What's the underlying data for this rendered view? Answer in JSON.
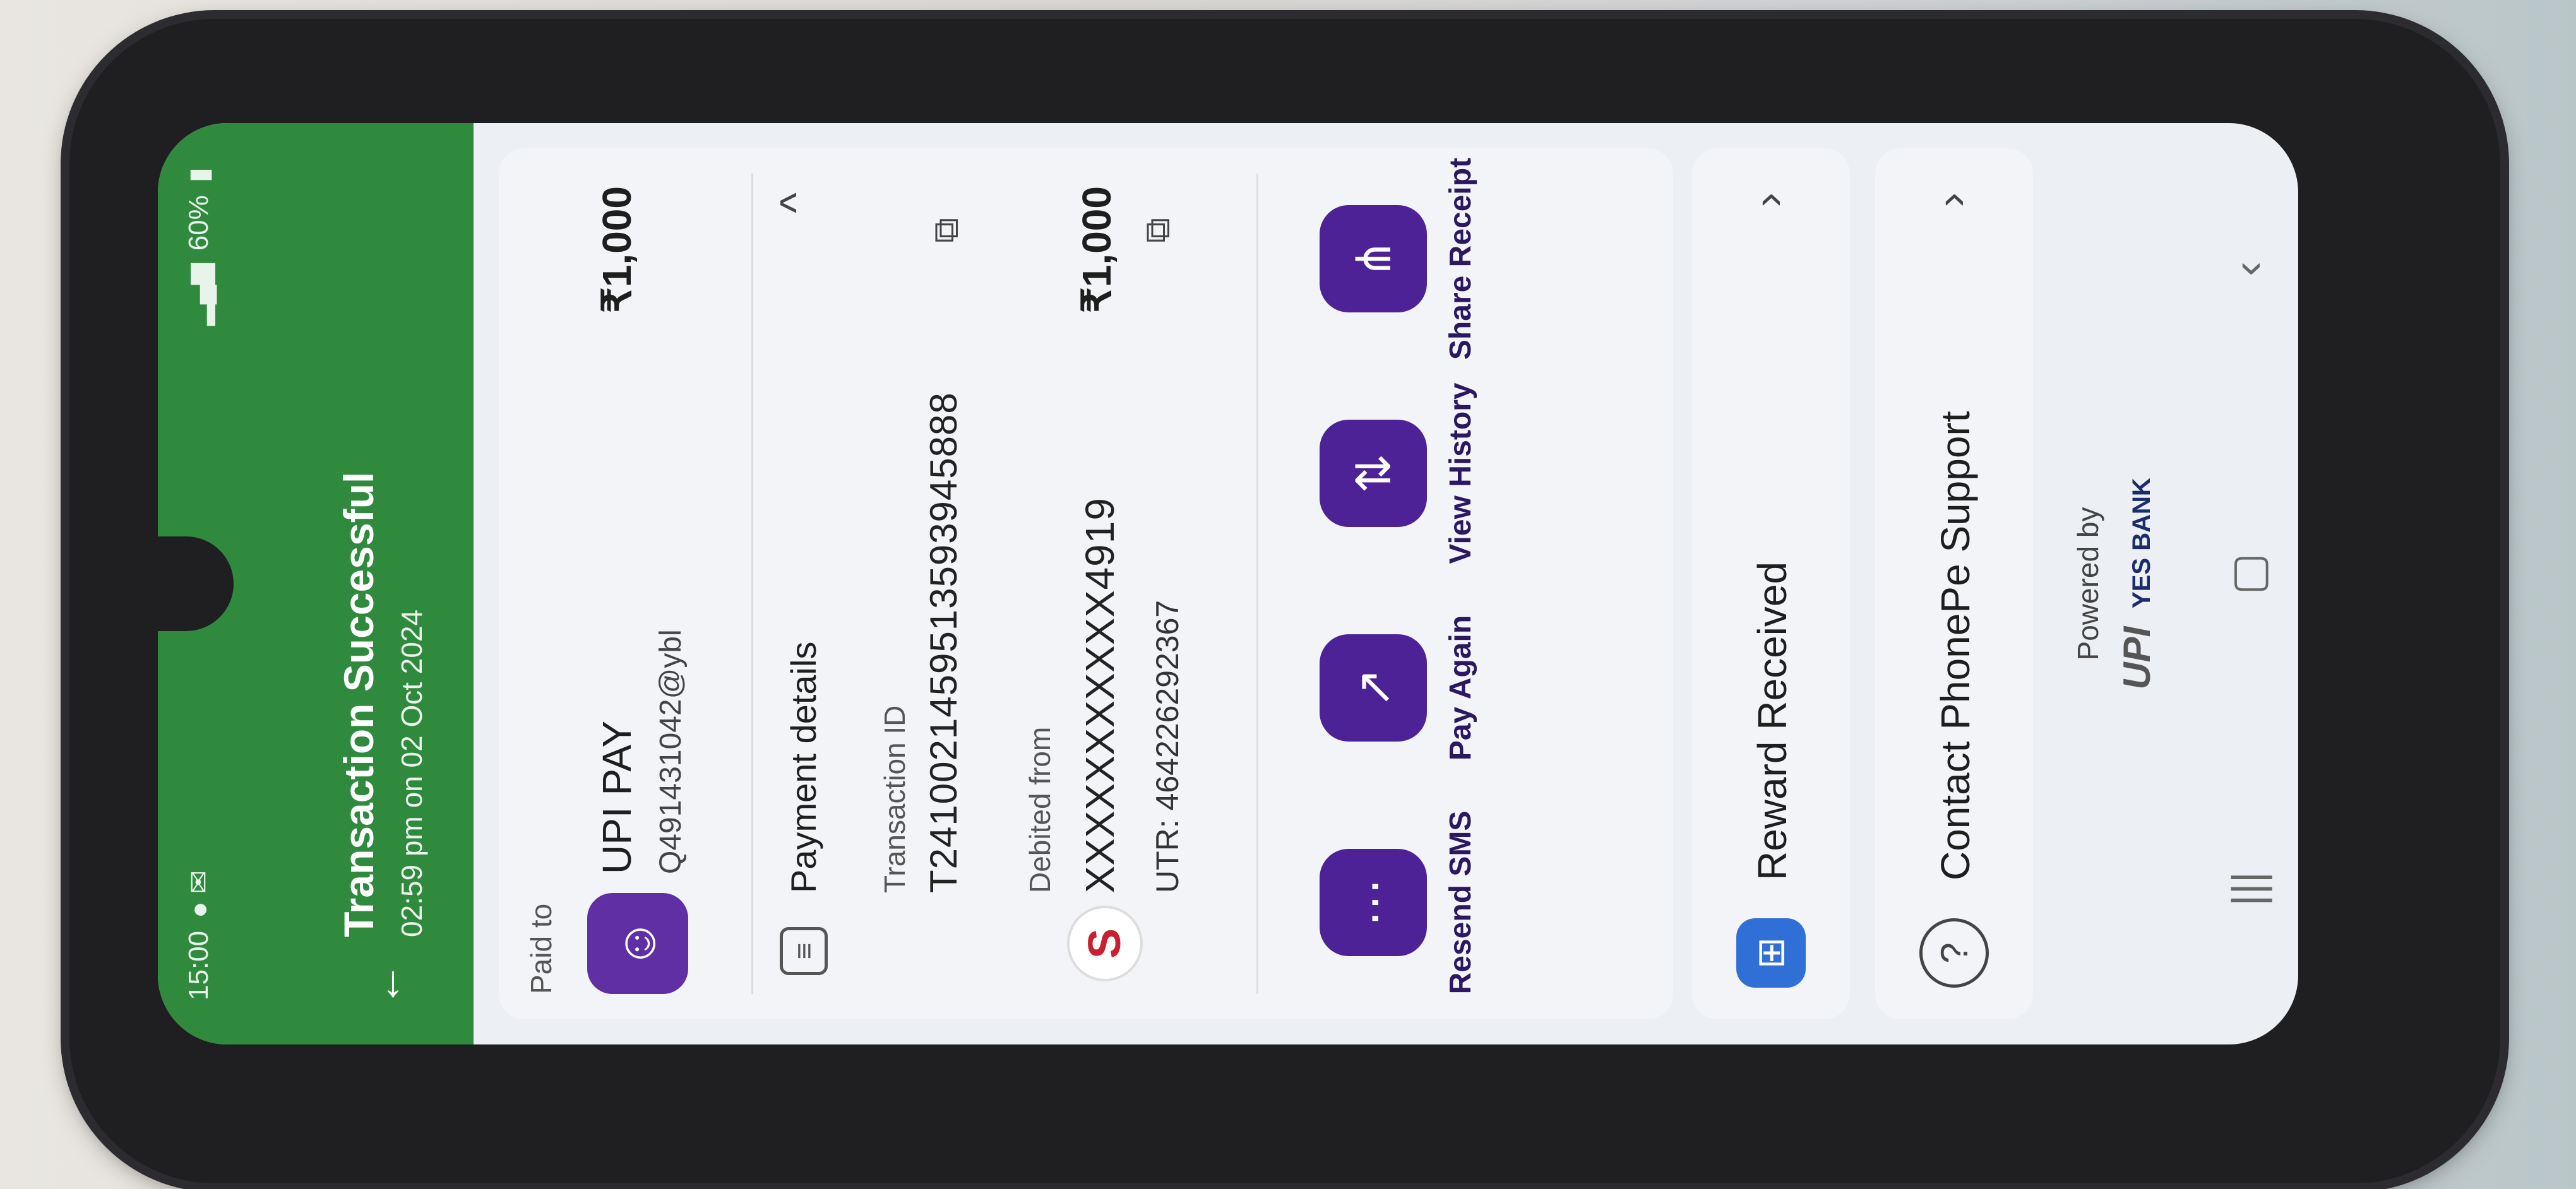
{
  "status_bar": {
    "time": "15:00",
    "battery": "60%"
  },
  "header": {
    "title": "Transaction Successful",
    "subtitle": "02:59 pm on 02 Oct 2024"
  },
  "paid_to": {
    "label": "Paid to",
    "name": "UPI PAY",
    "upi_id": "Q491431042@ybl",
    "amount": "₹1,000"
  },
  "payment_details": {
    "title": "Payment details",
    "transaction_id_label": "Transaction ID",
    "transaction_id": "T2410021459513593945888",
    "debited_from_label": "Debited from",
    "account": "XXXXXXXXXXX4919",
    "utr": "UTR: 464226292367",
    "debited_amount": "₹1,000"
  },
  "actions": [
    {
      "label": "Resend SMS",
      "icon": "message-icon"
    },
    {
      "label": "Pay Again",
      "icon": "arrow-up-right-icon"
    },
    {
      "label": "View History",
      "icon": "swap-arrows-icon"
    },
    {
      "label": "Share Receipt",
      "icon": "share-icon"
    }
  ],
  "list": {
    "reward": "Reward Received",
    "support": "Contact PhonePe Support"
  },
  "footer": {
    "powered_by": "Powered by",
    "upi": "UPI",
    "bank": "YES BANK"
  },
  "colors": {
    "header_green": "#2f8a3e",
    "brand_purple": "#4d2296",
    "gift_blue": "#2f6fd6"
  }
}
